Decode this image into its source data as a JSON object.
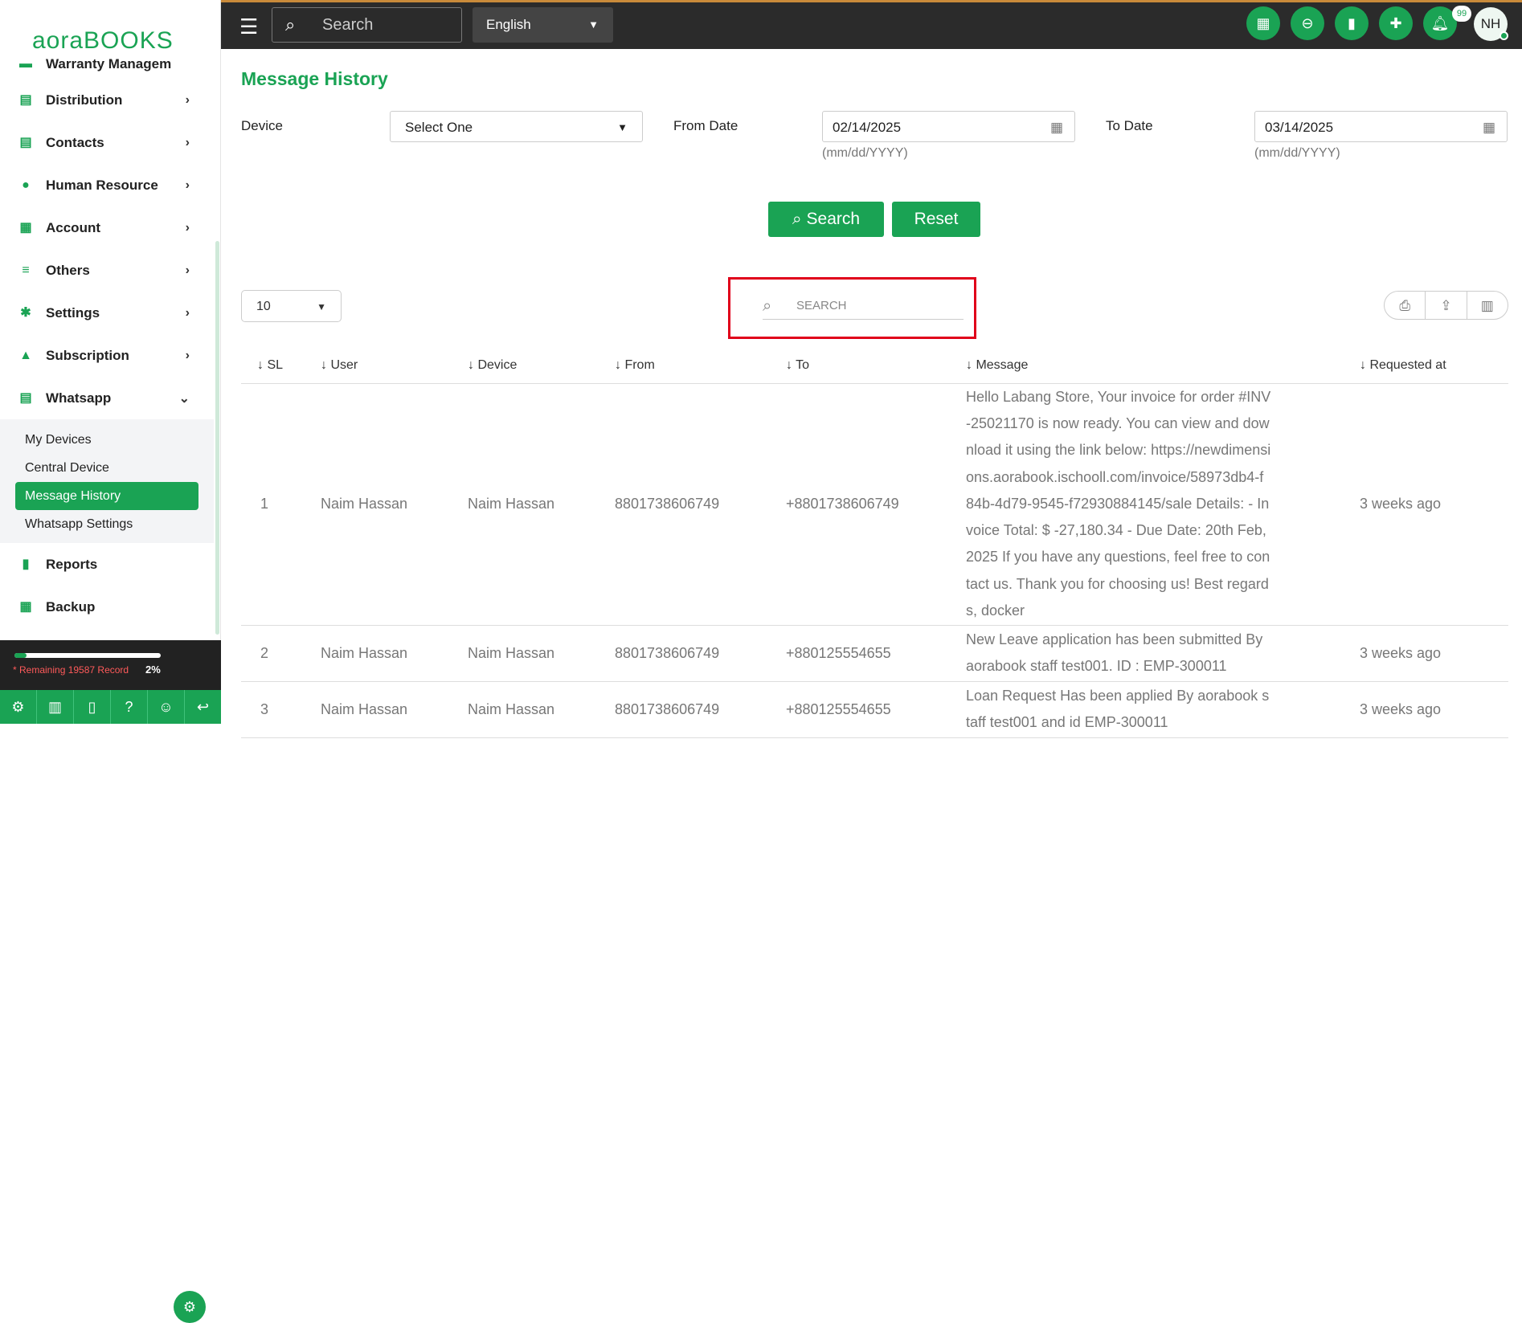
{
  "brand": {
    "logo": "aoraBOOKS"
  },
  "sidebar": {
    "items": [
      {
        "label": "Warranty Managem",
        "icon": "minus-icon"
      },
      {
        "label": "Distribution",
        "icon": "doc-icon"
      },
      {
        "label": "Contacts",
        "icon": "doc-icon"
      },
      {
        "label": "Human Resource",
        "icon": "users-icon"
      },
      {
        "label": "Account",
        "icon": "calculator-icon"
      },
      {
        "label": "Others",
        "icon": "list-icon"
      },
      {
        "label": "Settings",
        "icon": "gear-icon"
      },
      {
        "label": "Subscription",
        "icon": "bell-icon"
      },
      {
        "label": "Whatsapp",
        "icon": "doc-icon"
      }
    ],
    "whatsapp_sub": [
      {
        "label": "My Devices"
      },
      {
        "label": "Central Device"
      },
      {
        "label": "Message History",
        "active": true
      },
      {
        "label": "Whatsapp Settings"
      }
    ],
    "bottom_items": [
      {
        "label": "Reports",
        "icon": "signal-icon"
      },
      {
        "label": "Backup",
        "icon": "grid-icon"
      }
    ],
    "storage": {
      "text": "* Remaining 19587 Record",
      "percent": "2%",
      "fill": 0.02
    }
  },
  "topbar": {
    "search_placeholder": "Search",
    "language": "English",
    "notifications": "99",
    "avatar": "NH"
  },
  "page": {
    "title": "Message History",
    "device_label": "Device",
    "device_value": "Select One",
    "from_label": "From Date",
    "from_value": "02/14/2025",
    "to_label": "To Date",
    "to_value": "03/14/2025",
    "date_hint": "(mm/dd/YYYY)",
    "search_btn": "Search",
    "reset_btn": "Reset",
    "page_size": "10",
    "table_search_placeholder": "SEARCH"
  },
  "table": {
    "headers": [
      "SL",
      "User",
      "Device",
      "From",
      "To",
      "Message",
      "Requested at"
    ],
    "rows": [
      {
        "sl": "1",
        "user": "Naim Hassan",
        "device": "Naim Hassan",
        "from": "8801738606749",
        "to": "+8801738606749",
        "message": "Hello Labang Store, Your invoice for order #INV-25021170 is now ready. You can view and download it using the link below: https://newdimensions.aorabook.ischooll.com/invoice/58973db4-f84b-4d79-9545-f72930884145/sale Details: - Invoice Total: $ -27,180.34 - Due Date: 20th Feb, 2025 If you have any questions, feel free to contact us. Thank you for choosing us! Best regards, docker",
        "requested": "3 weeks ago"
      },
      {
        "sl": "2",
        "user": "Naim Hassan",
        "device": "Naim Hassan",
        "from": "8801738606749",
        "to": "+880125554655",
        "message": "New Leave application has been submitted By aorabook staff test001. ID : EMP-300011",
        "requested": "3 weeks ago"
      },
      {
        "sl": "3",
        "user": "Naim Hassan",
        "device": "Naim Hassan",
        "from": "8801738606749",
        "to": "+880125554655",
        "message": "Loan Request Has been applied By aorabook staff test001 and id EMP-300011",
        "requested": "3 weeks ago"
      }
    ]
  },
  "colors": {
    "accent": "#1aa354",
    "topbar": "#2b2b2b",
    "highlight": "#e0001a"
  }
}
